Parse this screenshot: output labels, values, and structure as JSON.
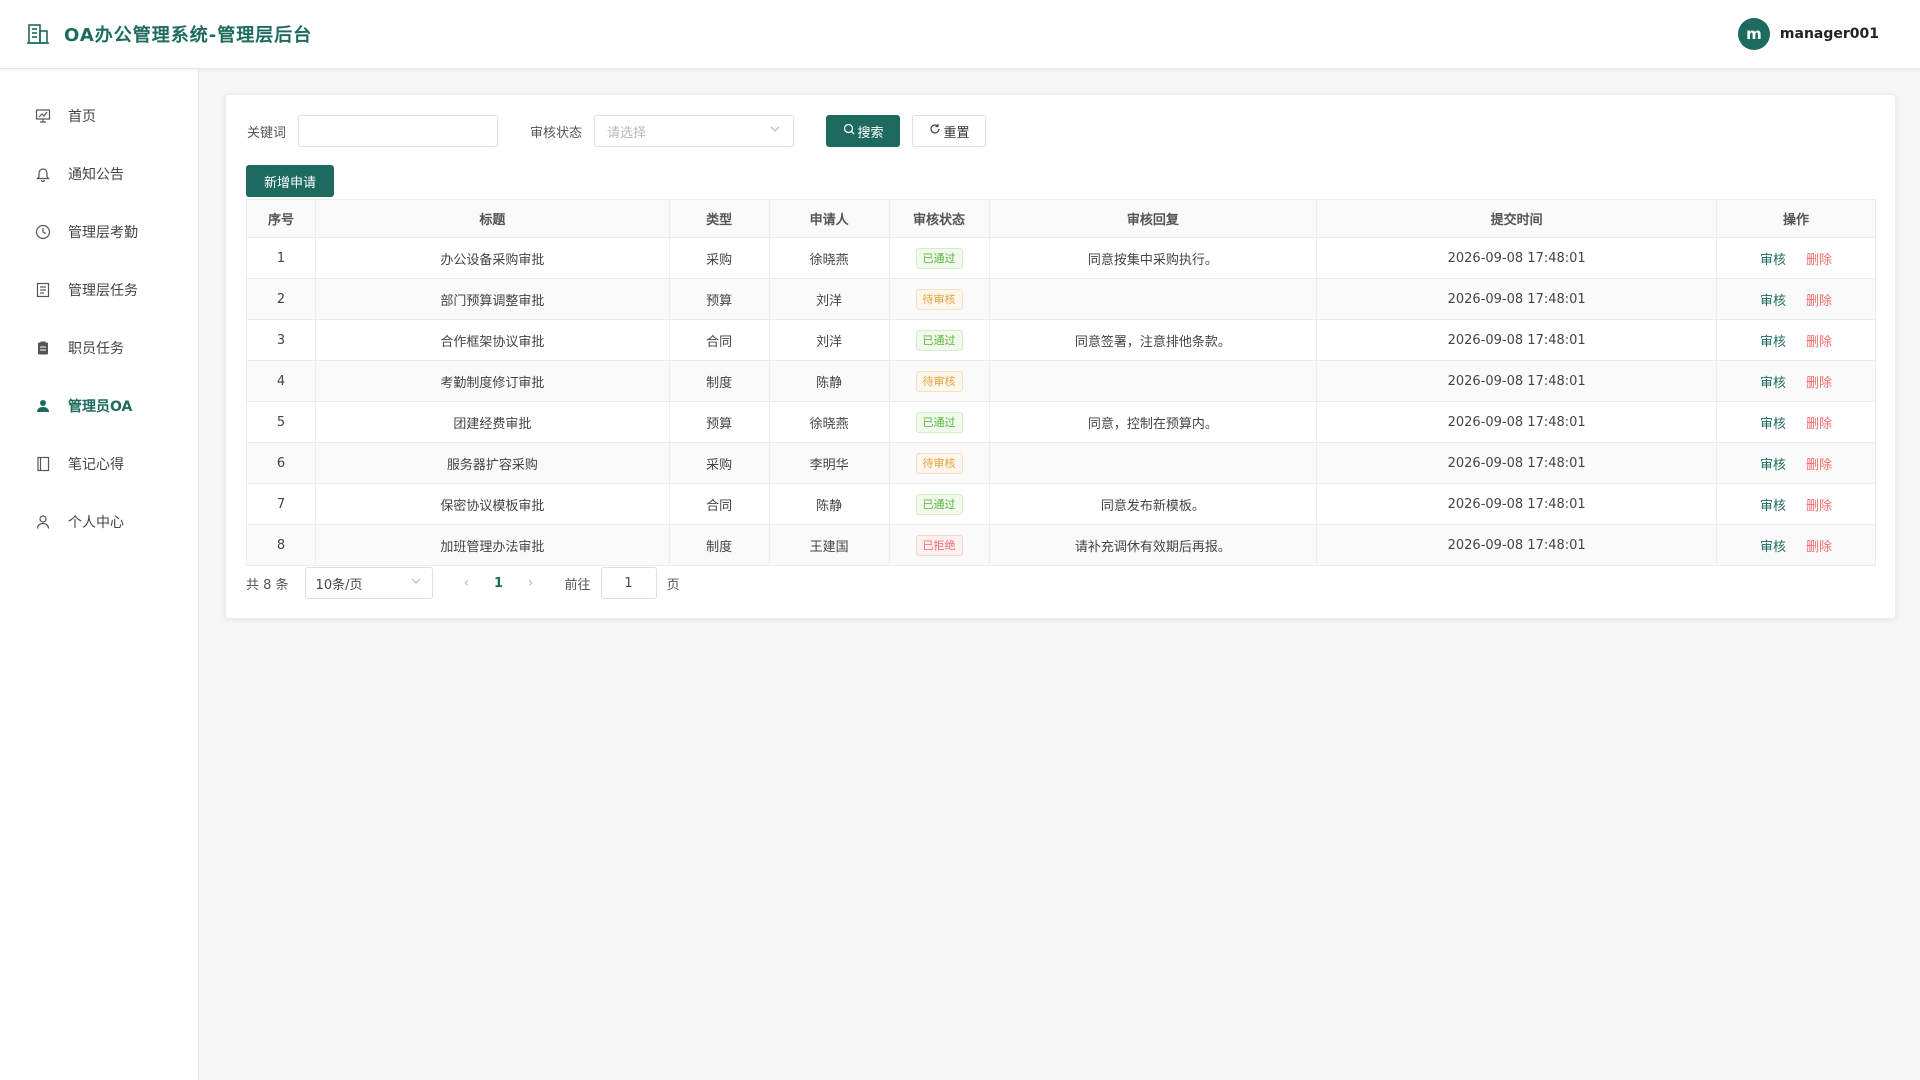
{
  "header": {
    "title": "OA办公管理系统-管理层后台",
    "avatar_letter": "m",
    "username": "manager001",
    "accent": "#1d6b5e"
  },
  "sidebar": {
    "items": [
      {
        "label": "首页",
        "icon": "presentation-chart-icon"
      },
      {
        "label": "通知公告",
        "icon": "bell-icon"
      },
      {
        "label": "管理层考勤",
        "icon": "clock-icon"
      },
      {
        "label": "管理层任务",
        "icon": "document-icon"
      },
      {
        "label": "职员任务",
        "icon": "clipboard-icon"
      },
      {
        "label": "管理员OA",
        "icon": "user-solid-icon",
        "active": true
      },
      {
        "label": "笔记心得",
        "icon": "notebook-icon"
      },
      {
        "label": "个人中心",
        "icon": "user-icon"
      }
    ]
  },
  "filters": {
    "keyword_label": "关键词",
    "keyword_value": "",
    "status_label": "审核状态",
    "status_placeholder": "请选择",
    "search_label": "搜索",
    "reset_label": "重置"
  },
  "add_button": "新增申请",
  "table": {
    "headers": [
      "序号",
      "标题",
      "类型",
      "申请人",
      "审核状态",
      "审核回复",
      "提交时间",
      "操作"
    ],
    "rows": [
      {
        "no": "1",
        "title": "办公设备采购审批",
        "type": "采购",
        "applicant": "徐晓燕",
        "status": "已通过",
        "reply": "同意按集中采购执行。",
        "time": "2026-09-08 17:48:01"
      },
      {
        "no": "2",
        "title": "部门预算调整审批",
        "type": "预算",
        "applicant": "刘洋",
        "status": "待审核",
        "reply": "",
        "time": "2026-09-08 17:48:01"
      },
      {
        "no": "3",
        "title": "合作框架协议审批",
        "type": "合同",
        "applicant": "刘洋",
        "status": "已通过",
        "reply": "同意签署，注意排他条款。",
        "time": "2026-09-08 17:48:01"
      },
      {
        "no": "4",
        "title": "考勤制度修订审批",
        "type": "制度",
        "applicant": "陈静",
        "status": "待审核",
        "reply": "",
        "time": "2026-09-08 17:48:01"
      },
      {
        "no": "5",
        "title": "团建经费审批",
        "type": "预算",
        "applicant": "徐晓燕",
        "status": "已通过",
        "reply": "同意，控制在预算内。",
        "time": "2026-09-08 17:48:01"
      },
      {
        "no": "6",
        "title": "服务器扩容采购",
        "type": "采购",
        "applicant": "李明华",
        "status": "待审核",
        "reply": "",
        "time": "2026-09-08 17:48:01"
      },
      {
        "no": "7",
        "title": "保密协议模板审批",
        "type": "合同",
        "applicant": "陈静",
        "status": "已通过",
        "reply": "同意发布新模板。",
        "time": "2026-09-08 17:48:01"
      },
      {
        "no": "8",
        "title": "加班管理办法审批",
        "type": "制度",
        "applicant": "王建国",
        "status": "已拒绝",
        "reply": "请补充调休有效期后再报。",
        "time": "2026-09-08 17:48:01"
      }
    ],
    "action_edit": "审核",
    "action_delete": "删除"
  },
  "pager": {
    "total": "共 8 条",
    "page_size": "10条/页",
    "current": "1",
    "goto_label": "前往",
    "goto_value": "1",
    "page_suffix": "页"
  }
}
